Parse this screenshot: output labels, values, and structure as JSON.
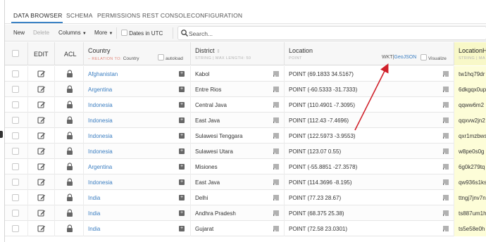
{
  "tabs": [
    {
      "label": "DATA BROWSER"
    },
    {
      "label": "SCHEMA"
    },
    {
      "label": "PERMISSIONS"
    },
    {
      "label": "REST CONSOLE"
    },
    {
      "label": "CONFIGURATION"
    }
  ],
  "toolbar": {
    "new_label": "New",
    "delete_label": "Delete",
    "columns_label": "Columns",
    "more_label": "More",
    "dates_utc_label": "Dates in UTC",
    "search_placeholder": "Search..."
  },
  "header": {
    "edit": "EDIT",
    "acl": "ACL",
    "country": {
      "title": "Country",
      "relation_prefix": "– RELATION TO:",
      "relation_target": "Country",
      "autoload": "autoload"
    },
    "district": {
      "title": "District",
      "sub": "STRING | MAX LENGTH: 50"
    },
    "location": {
      "title": "Location",
      "sub": "POINT",
      "wkt": "WKT",
      "sep": "|",
      "geojson": "GeoJSON",
      "visualize": "Visualize"
    },
    "locationh": {
      "title": "LocationH",
      "sub": "STRING | MA"
    }
  },
  "rows": [
    {
      "country": "Afghanistan",
      "district": "Kabol",
      "location": "POINT (69.1833 34.5167)",
      "locationh": "tw1hq79dr"
    },
    {
      "country": "Argentina",
      "district": "Entre Rios",
      "location": "POINT (-60.5333 -31.7333)",
      "locationh": "6dkgqx0up"
    },
    {
      "country": "Indonesia",
      "district": "Central Java",
      "location": "POINT (110.4901 -7.3095)",
      "locationh": "qqww6m2"
    },
    {
      "country": "Indonesia",
      "district": "East Java",
      "location": "POINT (112.43 -7.4696)",
      "locationh": "qqxvw2jn2"
    },
    {
      "country": "Indonesia",
      "district": "Sulawesi Tenggara",
      "location": "POINT (122.5973 -3.9553)",
      "locationh": "qxr1mzbws"
    },
    {
      "country": "Indonesia",
      "district": "Sulawesi Utara",
      "location": "POINT (123.07 0.55)",
      "locationh": "w8pe0s0g"
    },
    {
      "country": "Argentina",
      "district": "Misiones",
      "location": "POINT (-55.8851 -27.3578)",
      "locationh": "6g0k279tq"
    },
    {
      "country": "Indonesia",
      "district": "East Java",
      "location": "POINT (114.3696 -8.195)",
      "locationh": "qw936s1ks"
    },
    {
      "country": "India",
      "district": "Delhi",
      "location": "POINT (77.23 28.67)",
      "locationh": "ttngj7jnv7n"
    },
    {
      "country": "India",
      "district": "Andhra Pradesh",
      "location": "POINT (68.375 25.38)",
      "locationh": "ts887um1h"
    },
    {
      "country": "India",
      "district": "Gujarat",
      "location": "POINT (72.58 23.0301)",
      "locationh": "ts5e58e0h"
    }
  ],
  "colors": {
    "accent": "#3b82c4",
    "link": "#3b7ec1",
    "arrow": "#d0202a",
    "highlight_column": "#fdfdd8"
  }
}
